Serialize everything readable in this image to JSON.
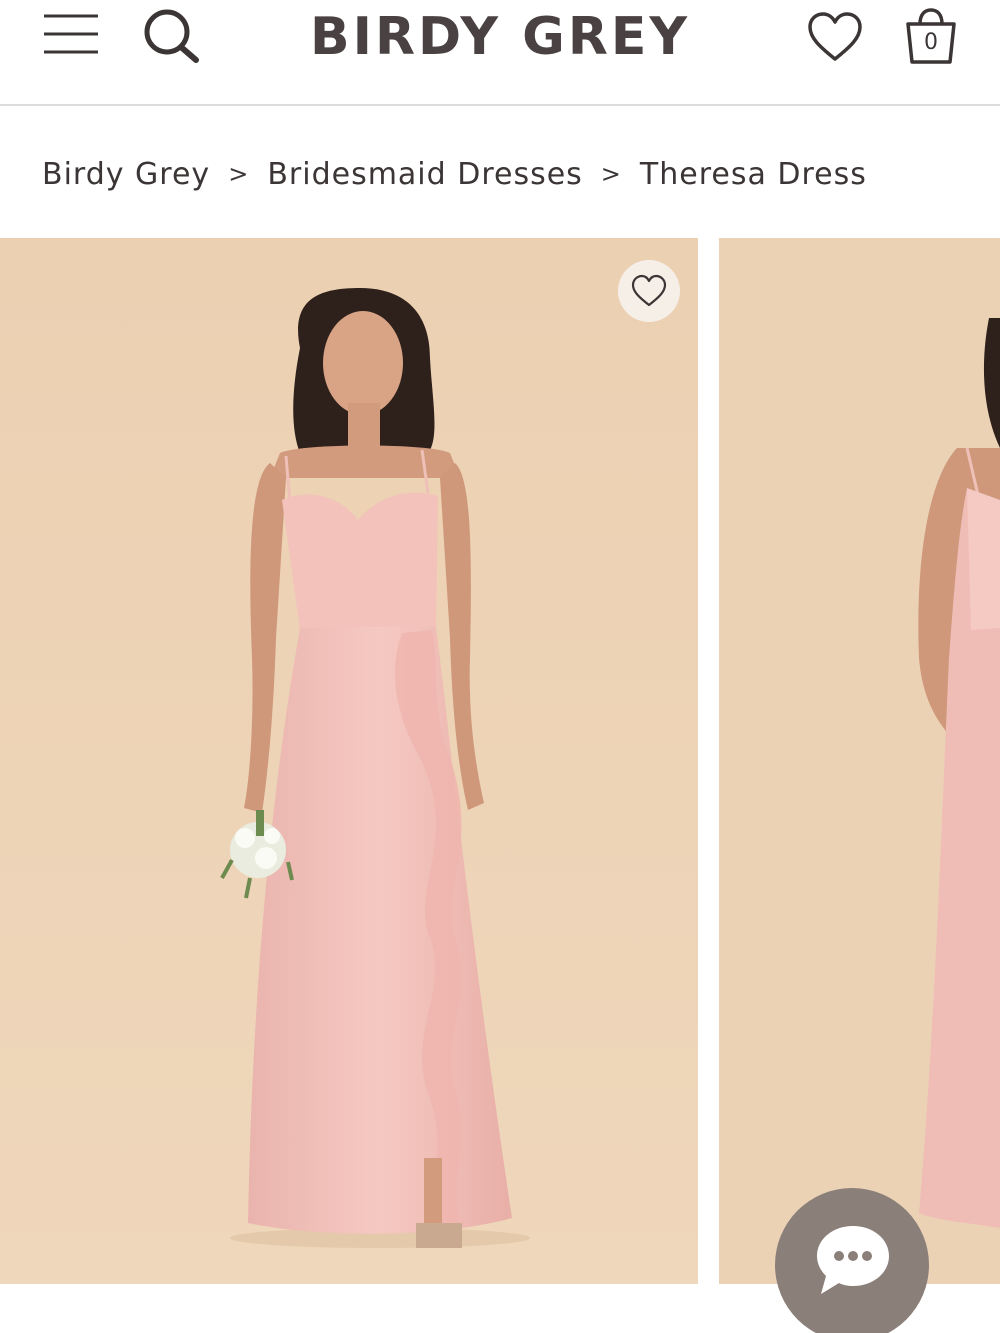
{
  "header": {
    "brand": "BIRDY GREY",
    "cart_count": "0",
    "icons": {
      "menu": "hamburger-menu-icon",
      "search": "search-icon",
      "wishlist": "heart-icon",
      "cart": "shopping-bag-icon"
    }
  },
  "breadcrumb": {
    "items": [
      "Birdy Grey",
      "Bridesmaid Dresses",
      "Theresa Dress"
    ],
    "separator": ">"
  },
  "gallery": {
    "slides": [
      {
        "alt": "Theresa Dress, blush pink satin gown with ruffle front slit, front view"
      },
      {
        "alt": "Theresa Dress, blush pink satin gown, second view"
      }
    ],
    "favorite_icon": "heart-icon"
  },
  "chat": {
    "icon": "chat-bubble-icon"
  },
  "colors": {
    "brand_text": "#4a4242",
    "background_beige": "#ecd3b6",
    "dress_blush": "#f1bfb8",
    "chat_button": "#8b7f7a"
  }
}
